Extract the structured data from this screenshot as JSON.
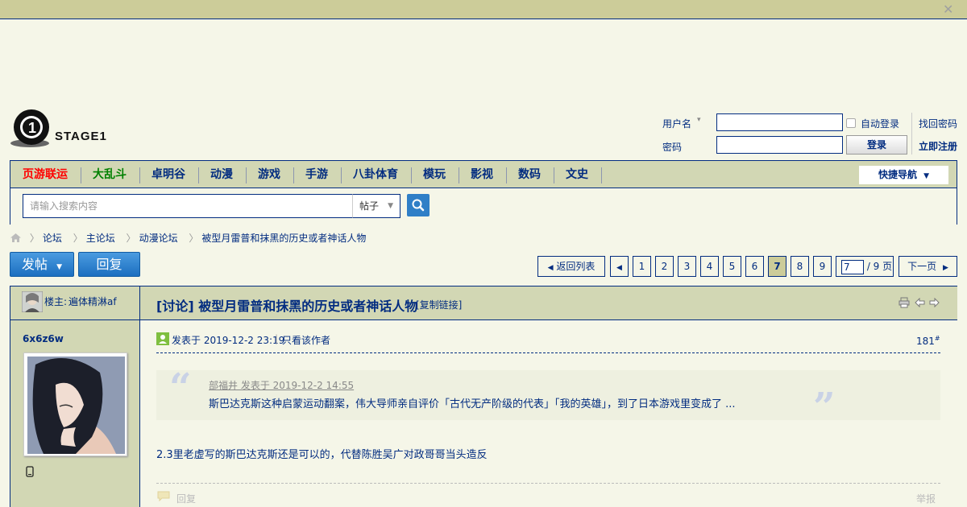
{
  "header": {
    "logo_text": "STAGE1",
    "login": {
      "username_label": "用户名",
      "password_label": "密码",
      "auto_login": "自动登录",
      "login_button": "登录",
      "forgot_password": "找回密码",
      "register": "立即注册"
    }
  },
  "nav": {
    "items": [
      {
        "label": "页游联运",
        "color": "#ff0000"
      },
      {
        "label": "大乱斗",
        "color": "#008000"
      },
      {
        "label": "卓明谷",
        "color": "#022c80"
      },
      {
        "label": "动漫",
        "color": "#022c80"
      },
      {
        "label": "游戏",
        "color": "#022c80"
      },
      {
        "label": "手游",
        "color": "#022c80"
      },
      {
        "label": "八卦体育",
        "color": "#022c80"
      },
      {
        "label": "模玩",
        "color": "#022c80"
      },
      {
        "label": "影视",
        "color": "#022c80"
      },
      {
        "label": "数码",
        "color": "#022c80"
      },
      {
        "label": "文史",
        "color": "#022c80"
      }
    ],
    "quick_nav": "快捷导航"
  },
  "search": {
    "placeholder": "请输入搜索内容",
    "type": "帖子"
  },
  "breadcrumb": [
    "论坛",
    "主论坛",
    "动漫论坛",
    "被型月雷普和抹黑的历史或者神话人物"
  ],
  "actions": {
    "new_post": "发帖",
    "reply": "回复"
  },
  "pagination": {
    "back": "返回列表",
    "pages": [
      "1",
      "2",
      "3",
      "4",
      "5",
      "6",
      "7",
      "8",
      "9"
    ],
    "current": "7",
    "page_input": "7",
    "total": "/ 9 页",
    "next": "下一页"
  },
  "thread": {
    "op_label": "楼主:",
    "op_name": "遍体精淋af",
    "title": "[讨论] 被型月雷普和抹黑的历史或者神话人物",
    "copy_link": "[复制链接]"
  },
  "post": {
    "author": "6x6z6w",
    "posted_at": "发表于 2019-12-2 23:19",
    "only_author": "只看该作者",
    "floor": "181",
    "floor_mark": "#",
    "quote_header": "部福井 发表于 2019-12-2 14:55",
    "quote_text": "斯巴达克斯这种启蒙运动翻案，伟大导师亲自评价「古代无产阶级的代表」「我的英雄」，到了日本游戏里变成了 ...",
    "body": "2.3里老虚写的斯巴达克斯还是可以的，代替陈胜吴广对政哥哥当头造反",
    "reply": "回复",
    "report": "举报"
  },
  "colors": {
    "accent": "#022c80",
    "header_band": "#cccc99",
    "panel": "#d2d7b4",
    "background": "#f5f6e8",
    "button_blue": "#2f7fc7"
  }
}
